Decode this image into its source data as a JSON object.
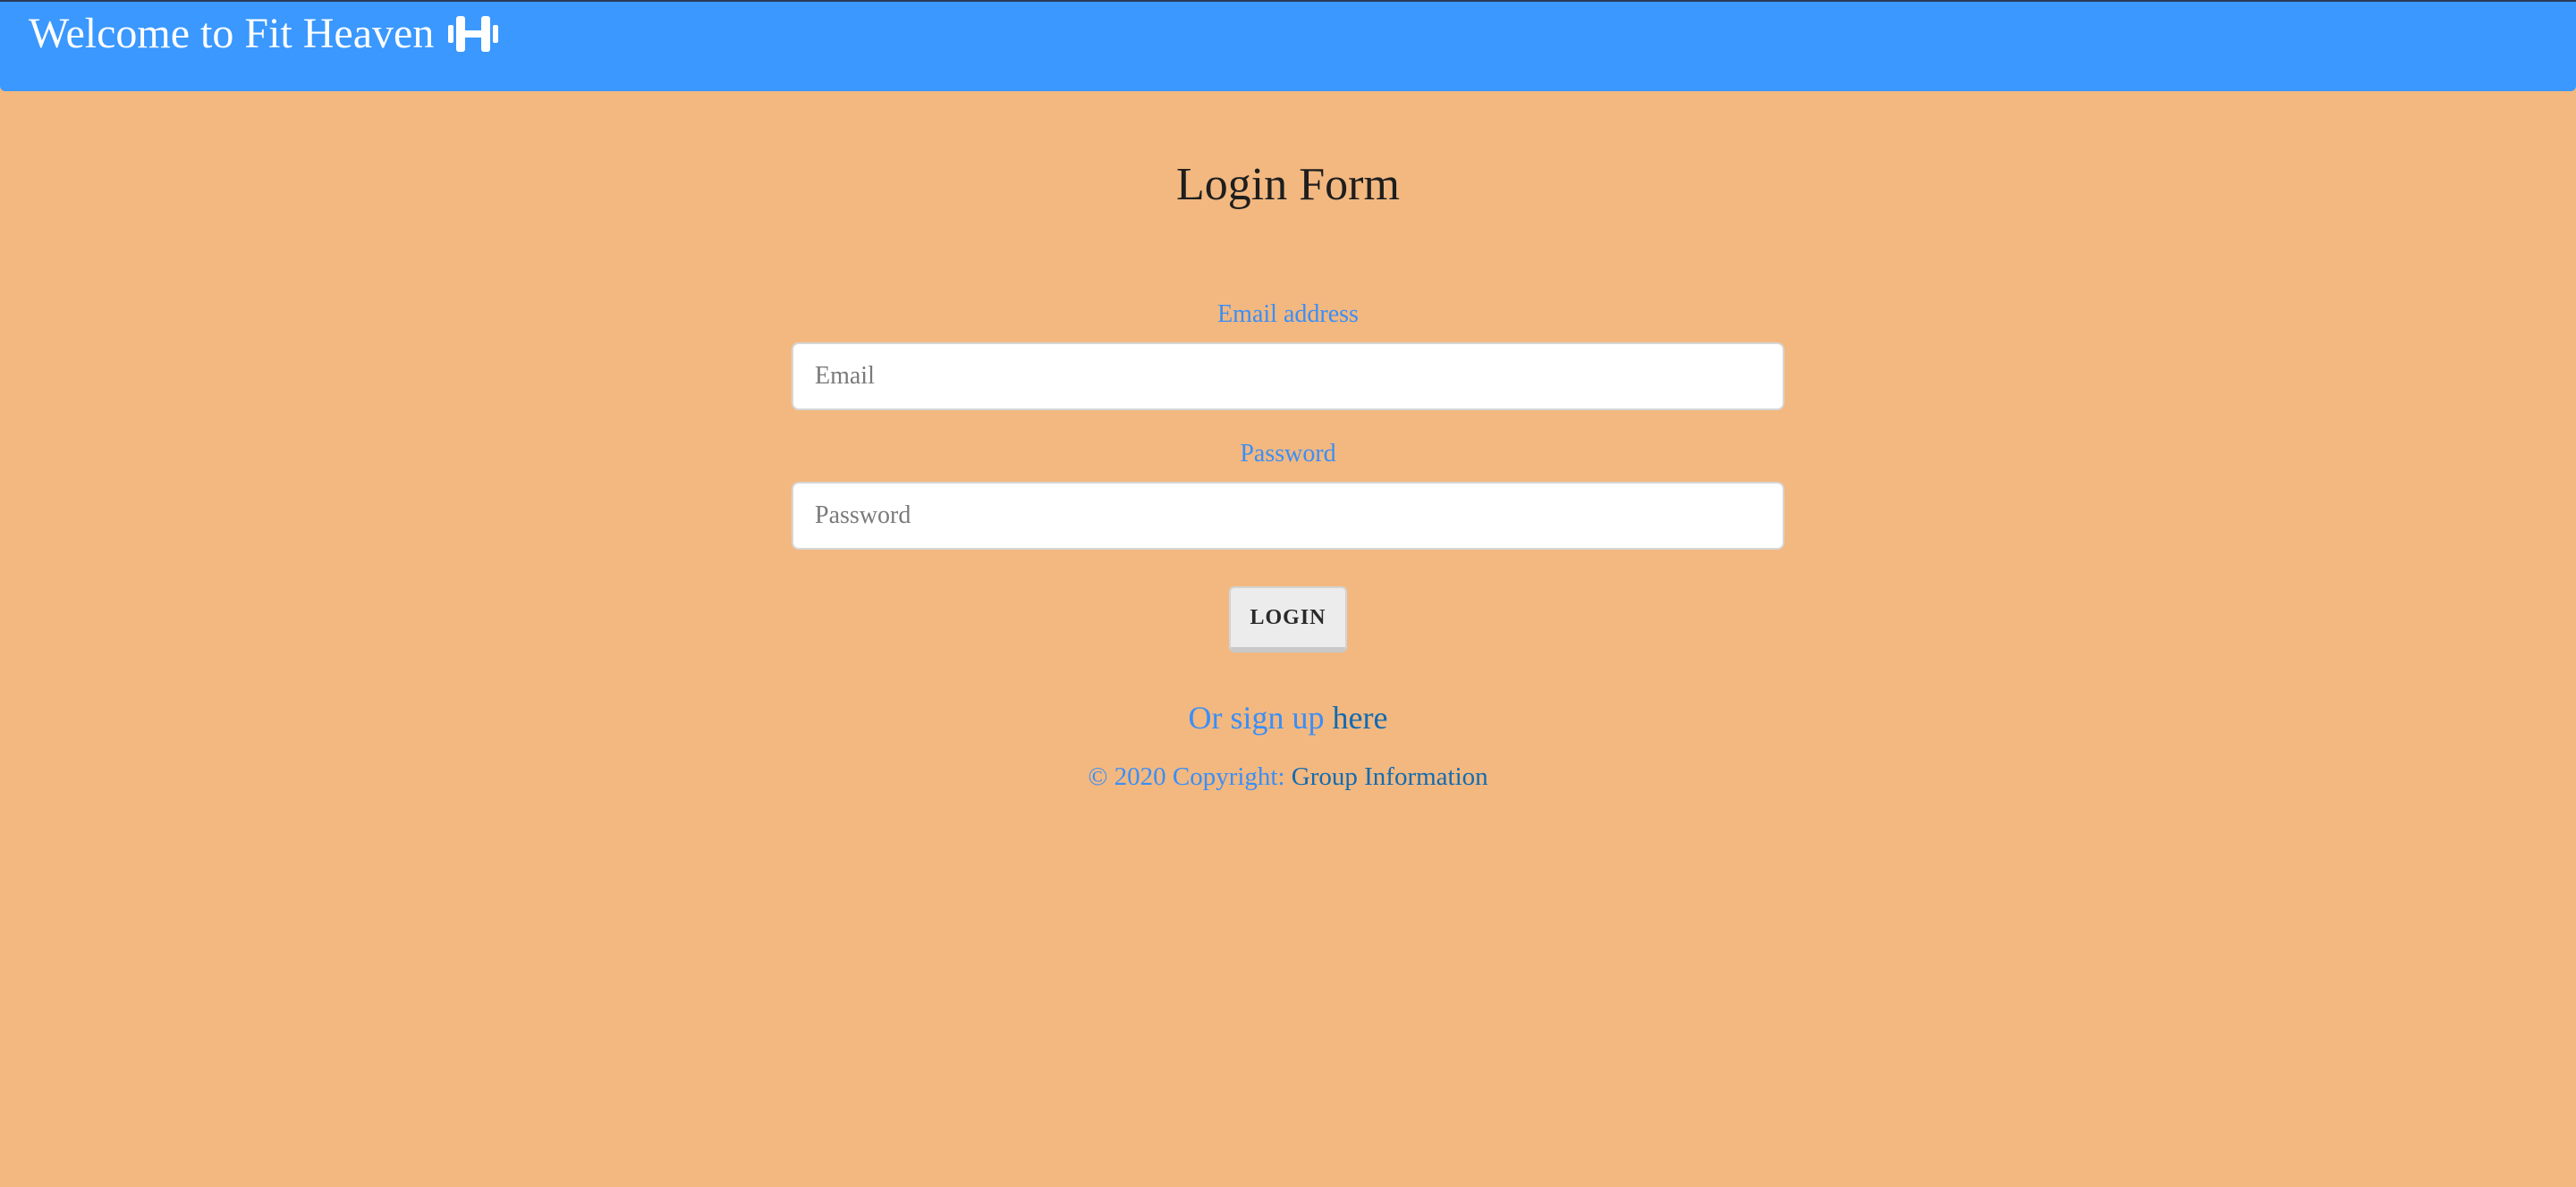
{
  "header": {
    "title": "Welcome to Fit Heaven",
    "icon": "dumbbell-icon",
    "background": "#3a98ff"
  },
  "form": {
    "title": "Login Form",
    "email": {
      "label": "Email address",
      "placeholder": "Email",
      "value": ""
    },
    "password": {
      "label": "Password",
      "placeholder": "Password",
      "value": ""
    },
    "submit_label": "LOGIN"
  },
  "signup": {
    "prefix": "Or sign up",
    "link_label": "here"
  },
  "footer": {
    "copyright": "© 2020 Copyright:",
    "link_label": "Group Information"
  },
  "colors": {
    "page_background": "#f2b880",
    "accent_text": "#3a8ef7",
    "link": "#136bb0"
  }
}
